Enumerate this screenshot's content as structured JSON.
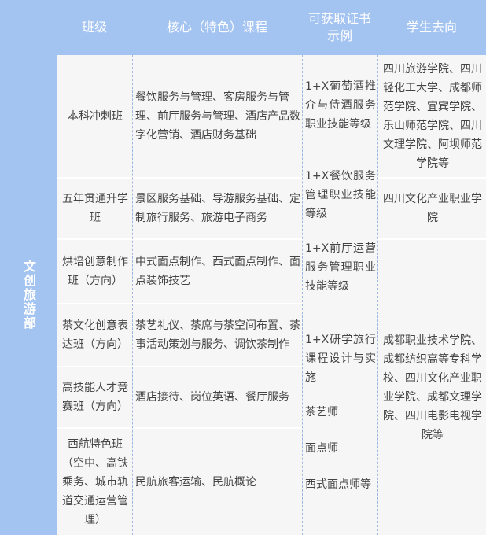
{
  "headers": {
    "class": "班级",
    "courses": "核心（特色）课程",
    "certificates": "可获取证书示例",
    "destinations": "学生去向"
  },
  "department": "文创旅游部",
  "classes": [
    {
      "name": "本科冲刺班",
      "courses": "餐饮服务与管理、客房服务与管理、前厅服务与管理、酒店产品数字化营销、酒店财务基础"
    },
    {
      "name": "五年贯通升学班",
      "courses": "景区服务基础、导游服务基础、定制旅行服务、旅游电子商务"
    },
    {
      "name": "烘培创意制作班（方向）",
      "courses": "中式面点制作、西式面点制作、面点装饰技艺"
    },
    {
      "name": "茶文化创意表达班（方向）",
      "courses": "茶艺礼仪、茶席与茶空间布置、茶事活动策划与服务、调饮茶制作"
    },
    {
      "name": "高技能人才竞赛班（方向）",
      "courses": "酒店接待、岗位英语、餐厅服务"
    },
    {
      "name": "西航特色班（空中、高铁乘务、城市轨道交通运营管理）",
      "courses": "民航旅客运输、民航概论"
    }
  ],
  "certificates": [
    "1+X葡萄酒推介与侍酒服务职业技能等级",
    "1+X餐饮服务管理职业技能等级",
    "1+X前厅运营服务管理职业技能等级",
    "1+X研学旅行课程设计与实施",
    "茶艺师",
    "面点师",
    "西式面点师等"
  ],
  "destinations": [
    "四川旅游学院、四川轻化工大学、成都师范学院、宜宾学院、乐山师范学院、四川文理学院、阿坝师范学院等",
    "四川文化产业职业学院",
    "成都职业技术学院、成都纺织高等专科学校、四川文化产业职业学院、成都文理学院、四川电影电视学院等"
  ],
  "colors": {
    "header_bg": "#a3c3f1",
    "header_text": "#ffffff",
    "cell_bg": "#f6f6f6",
    "body_text": "#444444"
  }
}
